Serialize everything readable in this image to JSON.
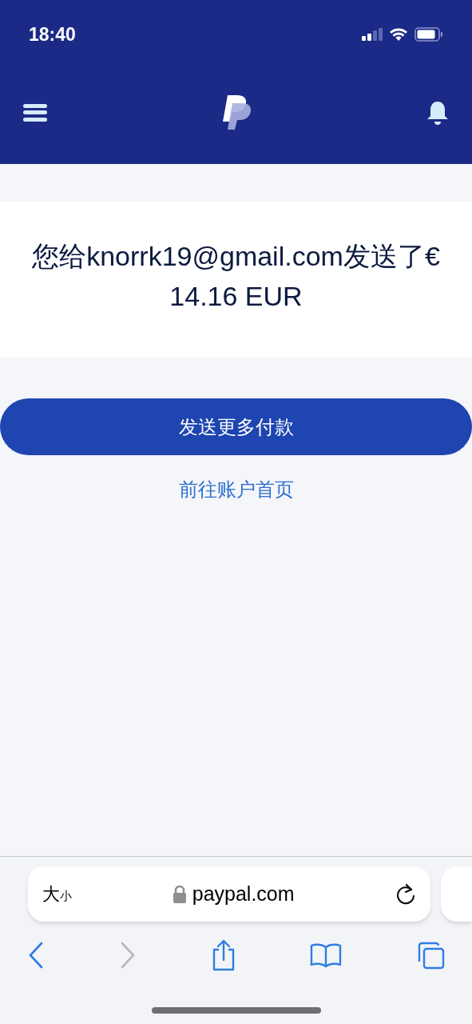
{
  "status_bar": {
    "time": "18:40"
  },
  "message": {
    "text": "您给knorrk19@gmail.com发送了€ 14.16 EUR"
  },
  "primary_button": {
    "label": "发送更多付款"
  },
  "link": {
    "label": "前往账户首页"
  },
  "browser": {
    "text_size": {
      "large": "大",
      "small": "小"
    },
    "url": "paypal.com",
    "forward_disabled": true
  }
}
